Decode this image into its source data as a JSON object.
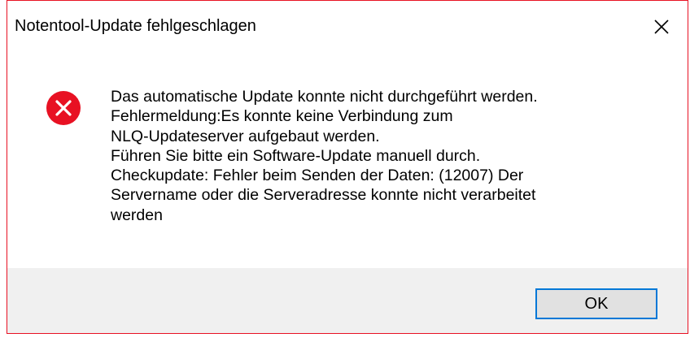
{
  "window": {
    "title": "Notentool-Update fehlgeschlagen",
    "close_icon": "close-icon",
    "border_color": "#e81123"
  },
  "icon": {
    "name": "error-icon",
    "color": "#e81123"
  },
  "message": {
    "text": "Das automatische Update konnte nicht durchgeführt werden.\nFehlermeldung:Es konnte keine Verbindung zum\nNLQ-Updateserver aufgebaut werden.\n Führen Sie bitte ein Software-Update manuell durch.\nCheckupdate: Fehler beim Senden der Daten: (12007) Der\nServername oder die Serveradresse konnte nicht verarbeitet\nwerden"
  },
  "buttons": {
    "ok_label": "OK",
    "accent": "#0078d7"
  }
}
